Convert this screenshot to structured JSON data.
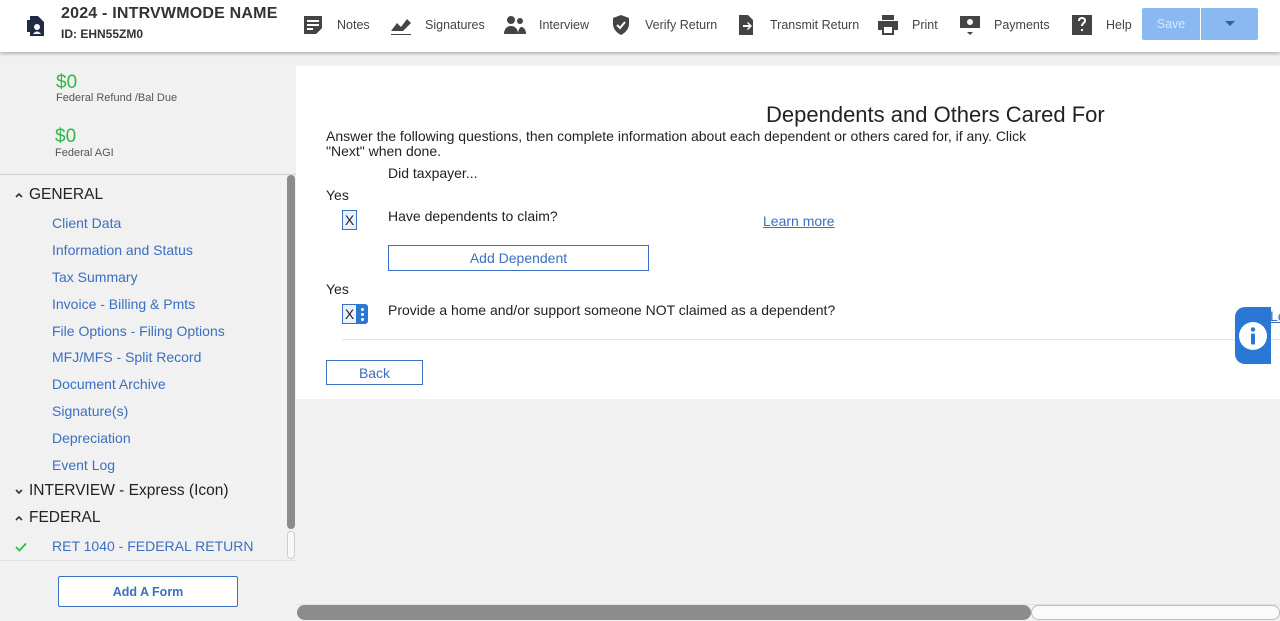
{
  "header": {
    "return_title": "2024 - INTRVWMODE NAME",
    "return_id": "ID: EHN55ZM0",
    "nav": [
      {
        "label": "Notes",
        "icon": "notes-icon"
      },
      {
        "label": "Signatures",
        "icon": "signature-icon"
      },
      {
        "label": "Interview",
        "icon": "people-icon"
      },
      {
        "label": "Verify Return",
        "icon": "shield-check-icon"
      },
      {
        "label": "Transmit Return",
        "icon": "transmit-icon"
      },
      {
        "label": "Print",
        "icon": "printer-icon"
      },
      {
        "label": "Payments",
        "icon": "payment-icon"
      },
      {
        "label": "Help",
        "icon": "help-icon"
      }
    ],
    "save_label": "Save"
  },
  "sidebar": {
    "refund_amount": "$0",
    "refund_label": "Federal Refund /Bal Due",
    "agi_amount": "$0",
    "agi_label": "Federal AGI",
    "sections": {
      "general": "GENERAL",
      "interview": "INTERVIEW - Express (Icon)",
      "federal": "FEDERAL"
    },
    "general_items": [
      "Client Data",
      "Information and Status",
      "Tax Summary",
      "Invoice - Billing & Pmts",
      "File Options - Filing Options",
      "MFJ/MFS - Split Record",
      "Document Archive",
      "Signature(s)",
      "Depreciation",
      "Event Log"
    ],
    "federal_items": [
      "RET 1040 - FEDERAL RETURN"
    ],
    "add_form_label": "Add A Form"
  },
  "main": {
    "title": "Dependents and Others Cared For",
    "instructions": "Answer the following questions, then complete information about each dependent or others cared for, if any. Click \"Next\" when done.",
    "did_taxpayer": "Did taxpayer...",
    "q1": {
      "yes_label": "Yes",
      "value": "X",
      "question": "Have dependents to claim?",
      "learn_more": "Learn more"
    },
    "add_dependent_label": "Add Dependent",
    "q2": {
      "yes_label": "Yes",
      "value": "X",
      "question": "Provide a home and/or support someone NOT claimed as a dependent?",
      "learn_more": "Le"
    },
    "back_label": "Back"
  },
  "colors": {
    "accent": "#3a6fc1",
    "amount_green": "#2eb84a",
    "save_disabled": "#8ab8f0",
    "info_tab": "#2a77d6"
  }
}
